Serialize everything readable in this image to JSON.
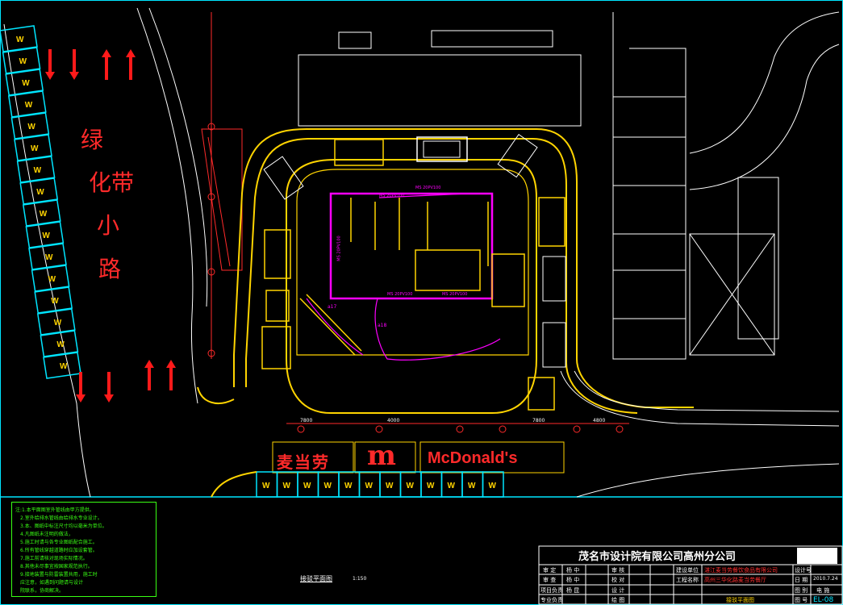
{
  "colors": {
    "background": "#000000",
    "wall": "#ffd400",
    "road": "#ffffff",
    "pipe": "#ff00ff",
    "arrow": "#ff1a1a",
    "grid": "#ff2a2a",
    "parking": "#00e5ff",
    "notes": "#39ff14"
  },
  "map": {
    "green_belt_label_1": "绿",
    "green_belt_label_2": "化带",
    "green_belt_label_3": "小",
    "green_belt_label_4": "路",
    "sign_cn": "麦当劳",
    "sign_en": "McDonald's",
    "parking_mark": "W",
    "dim_bottom_1": "7800",
    "dim_bottom_2": "4000",
    "dim_bottom_3": "7800",
    "dim_bottom_4": "4800",
    "pipe_label_1": "MS 20PV100",
    "pipe_label_2": "MS 20PV100",
    "pipe_label_3": "MS 20PV100",
    "pipe_label_4": "MS 20PV100",
    "pipe_label_5": "MS 20PV100",
    "tag_a17": "a17",
    "tag_a18": "a18"
  },
  "notes": {
    "lines": [
      "注:1.本平面图室外管线由甲方提供。",
      "2.室外给排水管线由给排水专业设计。",
      "3.本、图纸中标注尺寸均以毫米为单位。",
      "4.凡图纸未注明的做法，",
      "5.施工时请与各专业图纸配合施工。",
      "6.所有管线穿越道路时应加设套管。",
      "7.施工前请核对现场实际情况。",
      "8.其他未尽事宜按国家规范执行。",
      "9.接地装置与防雷装置共用，施工时",
      "  应注意，如遇到问题请与设计",
      "  院联系，协商解决。"
    ]
  },
  "sheet": {
    "title": "接驳平面图",
    "scale": "1:150"
  },
  "title_block": {
    "company": "茂名市设计院有限公司高州分公司",
    "client": "湛江麦当劳餐饮食品有限公司",
    "project": "高州三华化路麦当劳餐厅",
    "drawing_name": "接驳平面图",
    "row1": [
      "审 定",
      "杨 中",
      "审 核",
      "建设单位"
    ],
    "row2": [
      "审 查",
      "杨 中",
      "校 对",
      "工程名称"
    ],
    "row3": [
      "项目负责",
      "杨 昆",
      "设 计"
    ],
    "row4": [
      "专业负责",
      "",
      "绘 图"
    ],
    "meta_labels": [
      "设计号",
      "日 期",
      "图 别",
      "图 号"
    ],
    "date": "2010.7.24",
    "category": "电 施",
    "drawing_no": "EL-08"
  }
}
